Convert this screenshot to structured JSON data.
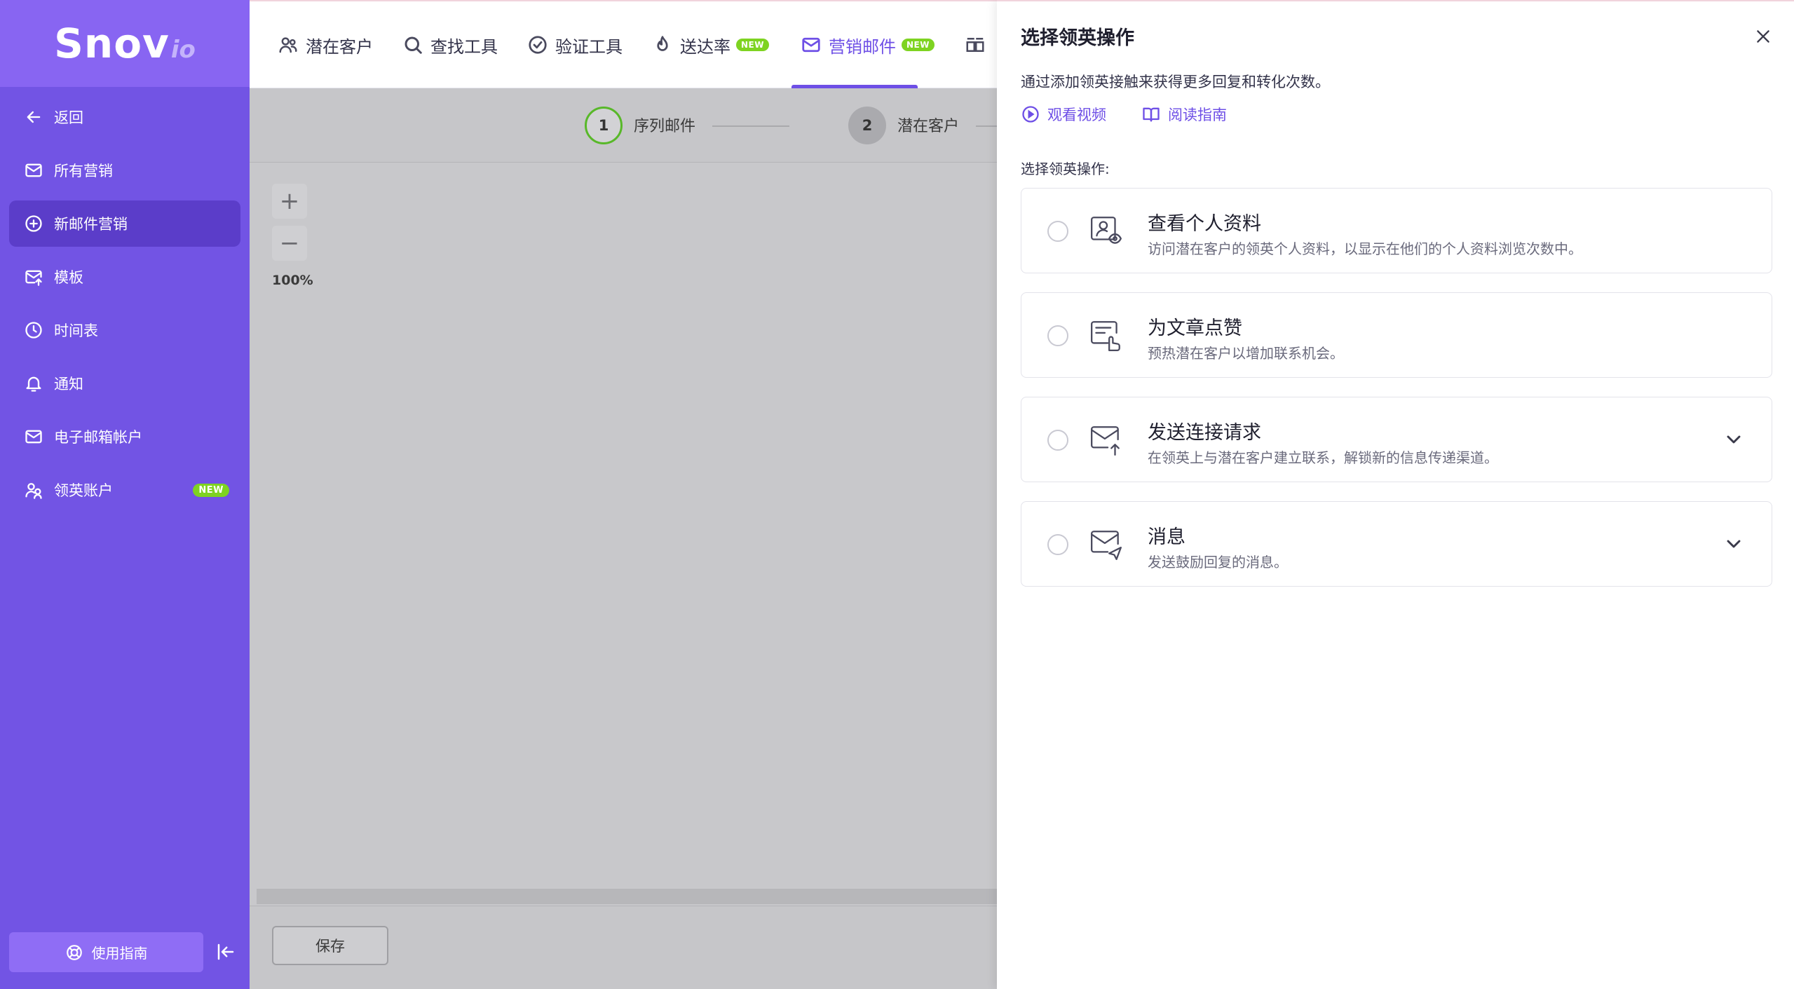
{
  "logo": {
    "main": "Snov",
    "suffix": "io"
  },
  "sidebar": {
    "items": [
      {
        "label": "返回",
        "icon": "arrow-left-icon"
      },
      {
        "label": "所有营销",
        "icon": "mail-icon"
      },
      {
        "label": "新邮件营销",
        "icon": "plus-circle-icon",
        "active": true
      },
      {
        "label": "模板",
        "icon": "mail-upload-icon"
      },
      {
        "label": "时间表",
        "icon": "clock-icon"
      },
      {
        "label": "通知",
        "icon": "bell-icon"
      },
      {
        "label": "电子邮箱帐户",
        "icon": "mail-icon"
      },
      {
        "label": "领英账户",
        "icon": "users-icon",
        "badge": "NEW"
      }
    ],
    "guide_label": "使用指南"
  },
  "topnav": {
    "tabs": [
      {
        "label": "潜在客户",
        "icon": "users-icon"
      },
      {
        "label": "查找工具",
        "icon": "search-icon"
      },
      {
        "label": "验证工具",
        "icon": "check-circle-icon"
      },
      {
        "label": "送达率",
        "icon": "flame-icon",
        "badge": "NEW"
      },
      {
        "label": "营销邮件",
        "icon": "mail-icon",
        "badge": "NEW",
        "active": true
      }
    ]
  },
  "stepper": {
    "steps": [
      {
        "num": "1",
        "label": "序列邮件"
      },
      {
        "num": "2",
        "label": "潜在客户"
      }
    ]
  },
  "canvas": {
    "zoom_in": "+",
    "zoom_out": "−",
    "zoom_level": "100%",
    "save_label": "保存"
  },
  "panel": {
    "title": "选择领英操作",
    "description": "通过添加领英接触来获得更多回复和转化次数。",
    "link_video": "观看视频",
    "link_guide": "阅读指南",
    "section_label": "选择领英操作:",
    "options": [
      {
        "title": "查看个人资料",
        "desc": "访问潜在客户的领英个人资料，以显示在他们的个人资料浏览次数中。",
        "icon": "profile-view-icon",
        "expandable": false
      },
      {
        "title": "为文章点赞",
        "desc": "预热潜在客户以增加联系机会。",
        "icon": "like-post-icon",
        "expandable": false
      },
      {
        "title": "发送连接请求",
        "desc": "在领英上与潜在客户建立联系，解锁新的信息传递渠道。",
        "icon": "connect-request-icon",
        "expandable": true
      },
      {
        "title": "消息",
        "desc": "发送鼓励回复的消息。",
        "icon": "message-send-icon",
        "expandable": true
      }
    ]
  },
  "colors": {
    "sidebar_bg": "#7254e4",
    "accent": "#6e4fe6",
    "badge_green": "#7ed321"
  }
}
